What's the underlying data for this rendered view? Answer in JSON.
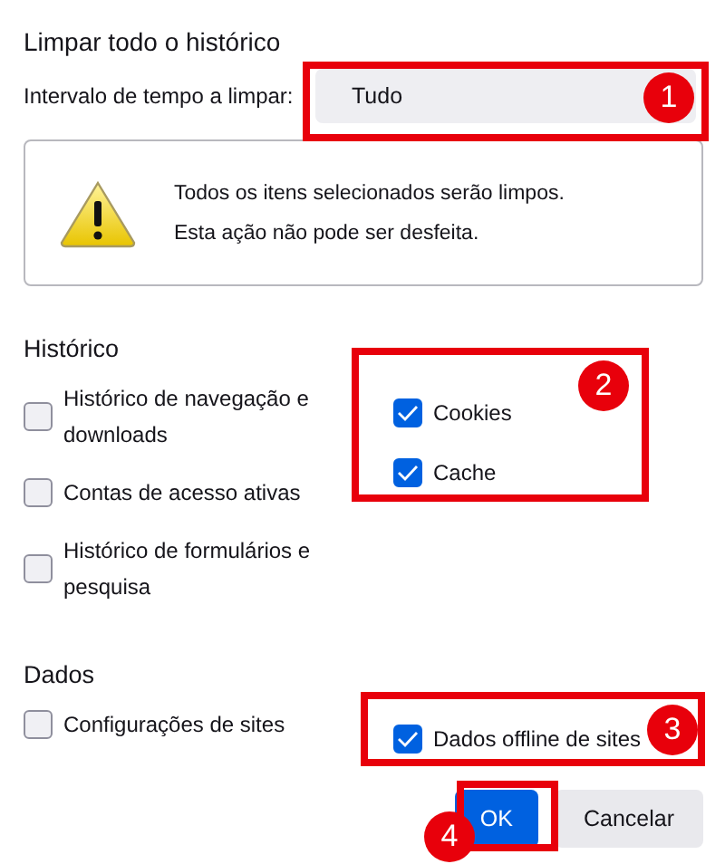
{
  "title": "Limpar todo o histórico",
  "range": {
    "label": "Intervalo de tempo a limpar:",
    "value": "Tudo"
  },
  "warning": {
    "lines": [
      "Todos os itens selecionados serão limpos.",
      "Esta ação não pode ser desfeita."
    ]
  },
  "sections": [
    {
      "heading": "Histórico",
      "left": [
        {
          "label": "Histórico de navegação e downloads",
          "checked": false
        },
        {
          "label": "Contas de acesso ativas",
          "checked": false
        },
        {
          "label": "Histórico de formulários e pesquisa",
          "checked": false
        }
      ],
      "right": [
        {
          "label": "Cookies",
          "checked": true
        },
        {
          "label": "Cache",
          "checked": true
        }
      ]
    },
    {
      "heading": "Dados",
      "left": [
        {
          "label": "Configurações de sites",
          "checked": false
        }
      ],
      "right": [
        {
          "label": "Dados offline de sites",
          "checked": true
        }
      ]
    }
  ],
  "buttons": [
    {
      "label": "OK",
      "primary": true
    },
    {
      "label": "Cancelar",
      "primary": false
    }
  ],
  "annotations": [
    {
      "label": "1"
    },
    {
      "label": "2"
    },
    {
      "label": "3"
    },
    {
      "label": "4"
    }
  ]
}
